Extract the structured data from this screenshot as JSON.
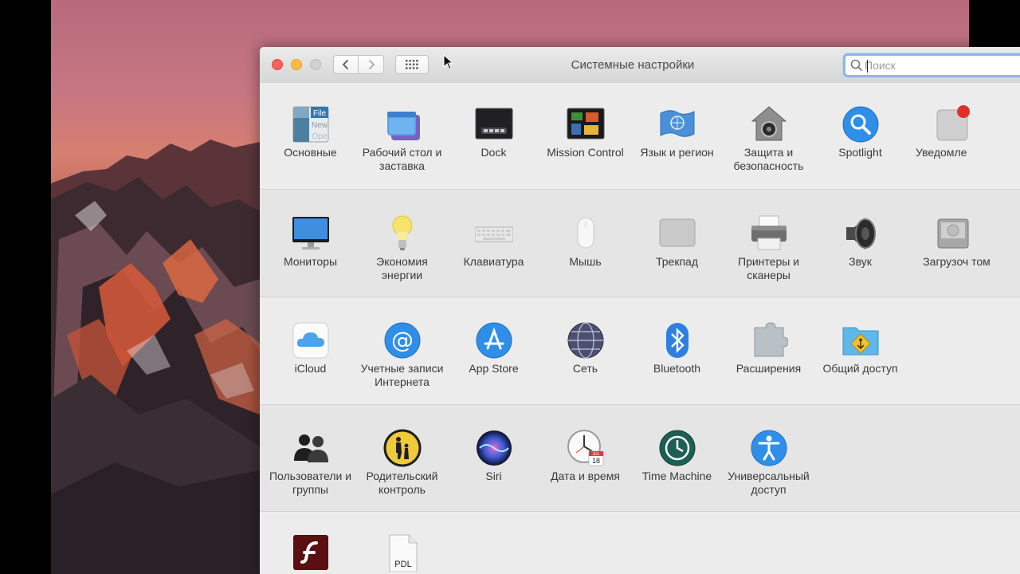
{
  "window": {
    "title": "Системные настройки",
    "search_placeholder": "Поиск"
  },
  "icons": {
    "back": "chevron-left-icon",
    "forward": "chevron-right-icon",
    "show_all": "grid-icon",
    "search": "magnifier-icon"
  },
  "colors": {
    "close": "#fc605b",
    "minimize": "#fdbc40",
    "search_focus": "#8fb6ea"
  },
  "rows": [
    {
      "panes": [
        {
          "label": "Основные",
          "icon": "general-icon"
        },
        {
          "label": "Рабочий стол и заставка",
          "icon": "desktop-screensaver-icon"
        },
        {
          "label": "Dock",
          "icon": "dock-icon"
        },
        {
          "label": "Mission Control",
          "icon": "mission-control-icon"
        },
        {
          "label": "Язык и регион",
          "icon": "language-region-icon"
        },
        {
          "label": "Защита и безопасность",
          "icon": "security-privacy-icon"
        },
        {
          "label": "Spotlight",
          "icon": "spotlight-icon"
        },
        {
          "label": "Уведомле",
          "icon": "notifications-icon"
        }
      ]
    },
    {
      "panes": [
        {
          "label": "Мониторы",
          "icon": "displays-icon"
        },
        {
          "label": "Экономия энергии",
          "icon": "energy-saver-icon"
        },
        {
          "label": "Клавиатура",
          "icon": "keyboard-icon"
        },
        {
          "label": "Мышь",
          "icon": "mouse-icon"
        },
        {
          "label": "Трекпад",
          "icon": "trackpad-icon"
        },
        {
          "label": "Принтеры и сканеры",
          "icon": "printers-scanners-icon"
        },
        {
          "label": "Звук",
          "icon": "sound-icon"
        },
        {
          "label": "Загрузоч том",
          "icon": "startup-disk-icon"
        }
      ]
    },
    {
      "panes": [
        {
          "label": "iCloud",
          "icon": "icloud-icon"
        },
        {
          "label": "Учетные записи Интернета",
          "icon": "internet-accounts-icon"
        },
        {
          "label": "App Store",
          "icon": "app-store-icon"
        },
        {
          "label": "Сеть",
          "icon": "network-icon"
        },
        {
          "label": "Bluetooth",
          "icon": "bluetooth-icon"
        },
        {
          "label": "Расширения",
          "icon": "extensions-icon"
        },
        {
          "label": "Общий доступ",
          "icon": "sharing-icon"
        }
      ]
    },
    {
      "panes": [
        {
          "label": "Пользователи и группы",
          "icon": "users-groups-icon"
        },
        {
          "label": "Родительский контроль",
          "icon": "parental-controls-icon"
        },
        {
          "label": "Siri",
          "icon": "siri-icon"
        },
        {
          "label": "Дата и время",
          "icon": "date-time-icon"
        },
        {
          "label": "Time Machine",
          "icon": "time-machine-icon"
        },
        {
          "label": "Универсальный доступ",
          "icon": "accessibility-icon"
        }
      ]
    },
    {
      "panes": [
        {
          "label": "",
          "icon": "flash-player-icon"
        },
        {
          "label": "",
          "icon": "pdl-icon",
          "badge": "PDL"
        }
      ]
    }
  ],
  "date_icon": {
    "month": "JUL",
    "day": "18"
  }
}
